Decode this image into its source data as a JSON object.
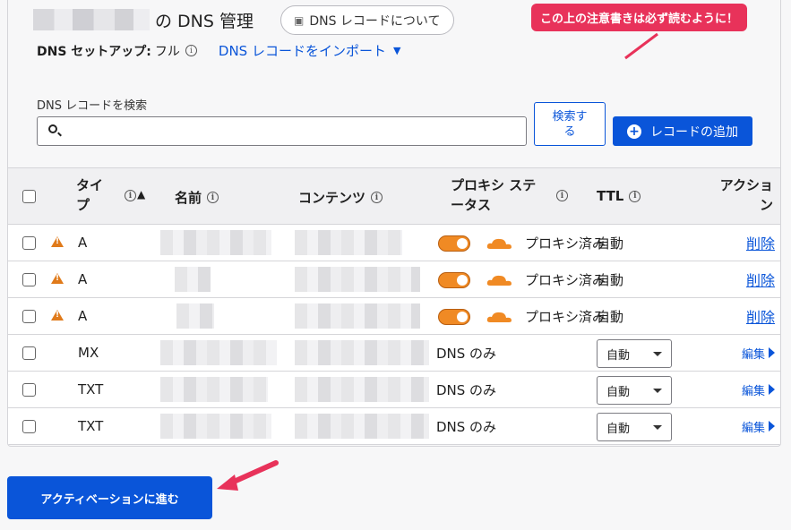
{
  "header": {
    "title_suffix": "の DNS 管理",
    "info_button": "DNS レコードについて",
    "notice": "この上の注意書きは必ず読むように！",
    "setup_label": "DNS セットアップ:",
    "setup_value": "フル",
    "import_link": "DNS レコードをインポート"
  },
  "search": {
    "label": "DNS レコードを検索",
    "placeholder": "",
    "value": "",
    "button_line1": "検索す",
    "button_line2": "る",
    "add_button": "レコードの追加"
  },
  "table": {
    "columns": {
      "type_line1": "タイ",
      "type_line2": "プ",
      "name": "名前",
      "content": "コンテンツ",
      "proxy_line1": "プロキシ ステ",
      "proxy_line2": "ータス",
      "ttl": "TTL",
      "action_line1": "アクショ",
      "action_line2": "ン"
    },
    "rows": [
      {
        "type": "A",
        "proxy": "プロキシ済み",
        "ttl": "自動",
        "action": "削除"
      },
      {
        "type": "A",
        "proxy": "プロキシ済み",
        "ttl": "自動",
        "action": "削除"
      },
      {
        "type": "A",
        "proxy": "プロキシ済み",
        "ttl": "自動",
        "action": "削除"
      },
      {
        "type": "MX",
        "proxy": "DNS のみ",
        "ttl": "自動",
        "action": "編集"
      },
      {
        "type": "TXT",
        "proxy": "DNS のみ",
        "ttl": "自動",
        "action": "編集"
      },
      {
        "type": "TXT",
        "proxy": "DNS のみ",
        "ttl": "自動",
        "action": "編集"
      }
    ]
  },
  "footer": {
    "activate_button": "アクティベーションに進む"
  },
  "colors": {
    "accent": "#0a55d9",
    "notice": "#e8325a",
    "proxy_orange": "#f08a24",
    "warning": "#e07a1a"
  }
}
